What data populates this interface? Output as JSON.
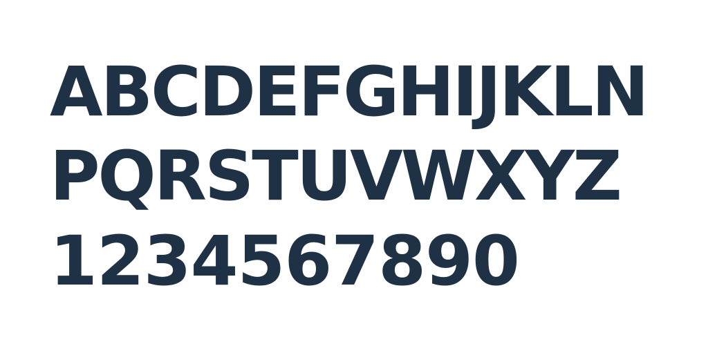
{
  "specimen": {
    "text_color": "#1f3145",
    "background_color": "#ffffff",
    "rows": [
      "ABCDEFGHIJKLN",
      "PQRSTUVWXYZ",
      "1234567890"
    ]
  }
}
